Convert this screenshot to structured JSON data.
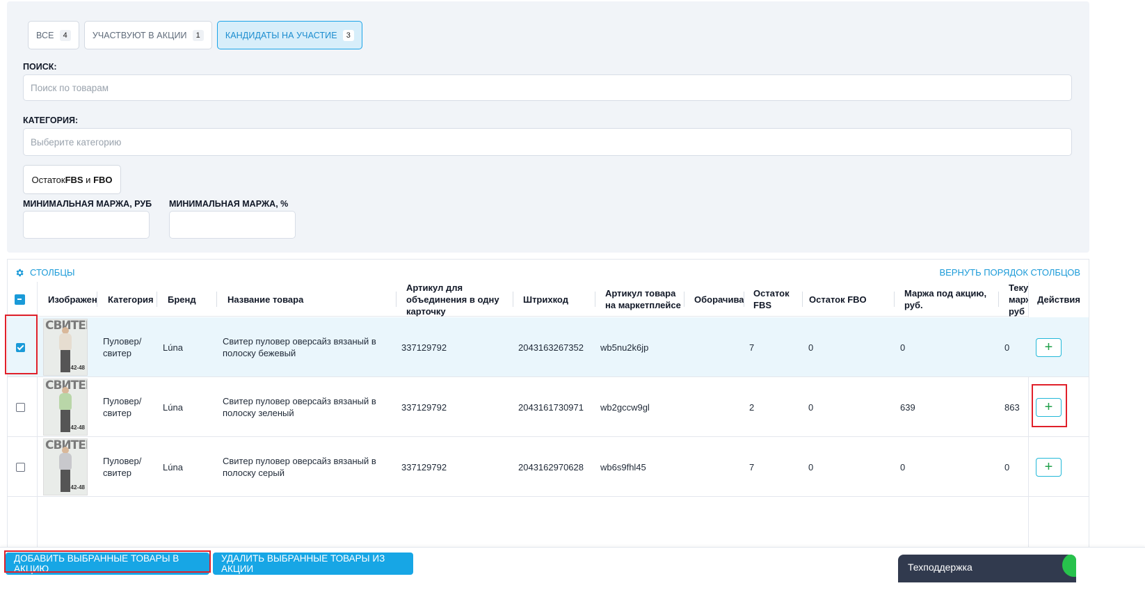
{
  "tabs": [
    {
      "label": "ВСЕ",
      "count": "4"
    },
    {
      "label": "УЧАСТВУЮТ В АКЦИИ",
      "count": "1"
    },
    {
      "label": "КАНДИДАТЫ НА УЧАСТИЕ",
      "count": "3"
    }
  ],
  "search": {
    "label": "ПОИСК:",
    "placeholder": "Поиск по товарам"
  },
  "category": {
    "label": "КАТЕГОРИЯ:",
    "placeholder": "Выберите категорию"
  },
  "stock_button": {
    "prefix": "Остаток ",
    "fbs": "FBS",
    "and": " и ",
    "fbo": "FBO"
  },
  "min_margin_rub": {
    "label": "МИНИМАЛЬНАЯ МАРЖА, РУБ",
    "value": ""
  },
  "min_margin_pct": {
    "label": "МИНИМАЛЬНАЯ МАРЖА, %",
    "value": ""
  },
  "table": {
    "columns_link": "СТОЛБЦЫ",
    "reset_link": "ВЕРНУТЬ ПОРЯДОК СТОЛБЦОВ",
    "headers": {
      "image": "Изображение",
      "category": "Категория",
      "brand": "Бренд",
      "name": "Название товара",
      "article_join": "Артикул для объединения в одну карточку",
      "barcode": "Штрихкод",
      "mp_article": "Артикул товара на маркетплейсе",
      "turnover": "Оборачиваемость",
      "fbs": "Остаток FBS",
      "fbo": "Остаток FBO",
      "margin_promo": "Маржа под акцию, руб.",
      "margin_current": "Текущая маржа, руб",
      "actions": "Действия"
    },
    "rows": [
      {
        "checked": true,
        "thumb_text": "СВИТЕР",
        "thumb_size": "42-48",
        "category": "Пуловер/ свитер",
        "brand": "Lúna",
        "name": "Свитер пуловер оверсайз вязаный в полоску бежевый",
        "article_join": "337129792",
        "barcode": "2043163267352",
        "mp_article": "wb5nu2k6jp",
        "turnover": "",
        "fbs": "7",
        "fbo": "0",
        "margin_promo": "0",
        "margin_current": "0",
        "action": "+",
        "sweater_color": "#e6ddd0"
      },
      {
        "checked": false,
        "thumb_text": "СВИТЕР",
        "thumb_size": "42-48",
        "category": "Пуловер/ свитер",
        "brand": "Lúna",
        "name": "Свитер пуловер оверсайз вязаный в полоску зеленый",
        "article_join": "337129792",
        "barcode": "2043161730971",
        "mp_article": "wb2gccw9gl",
        "turnover": "",
        "fbs": "2",
        "fbo": "0",
        "margin_promo": "639",
        "margin_current": "863",
        "action": "+",
        "sweater_color": "#b9d6a8"
      },
      {
        "checked": false,
        "thumb_text": "СВИТЕР",
        "thumb_size": "42-48",
        "category": "Пуловер/ свитер",
        "brand": "Lúna",
        "name": "Свитер пуловер оверсайз вязаный в полоску серый",
        "article_join": "337129792",
        "barcode": "2043162970628",
        "mp_article": "wb6s9fhl45",
        "turnover": "",
        "fbs": "7",
        "fbo": "0",
        "margin_promo": "0",
        "margin_current": "0",
        "action": "+",
        "sweater_color": "#c8c8cc"
      }
    ]
  },
  "footer": {
    "add_button": "ДОБАВИТЬ ВЫБРАННЫЕ ТОВАРЫ В АКЦИЮ",
    "remove_button": "УДАЛИТЬ ВЫБРАННЫЕ ТОВАРЫ ИЗ АКЦИИ",
    "support": "Техподдержка"
  },
  "colors": {
    "accent": "#1a9ad8",
    "button": "#17a6e5",
    "highlight": "#e0202a",
    "plus": "#20a04a"
  },
  "icons": {
    "columns": "gear-icon",
    "action": "plus-icon",
    "support": "chat-icon"
  }
}
